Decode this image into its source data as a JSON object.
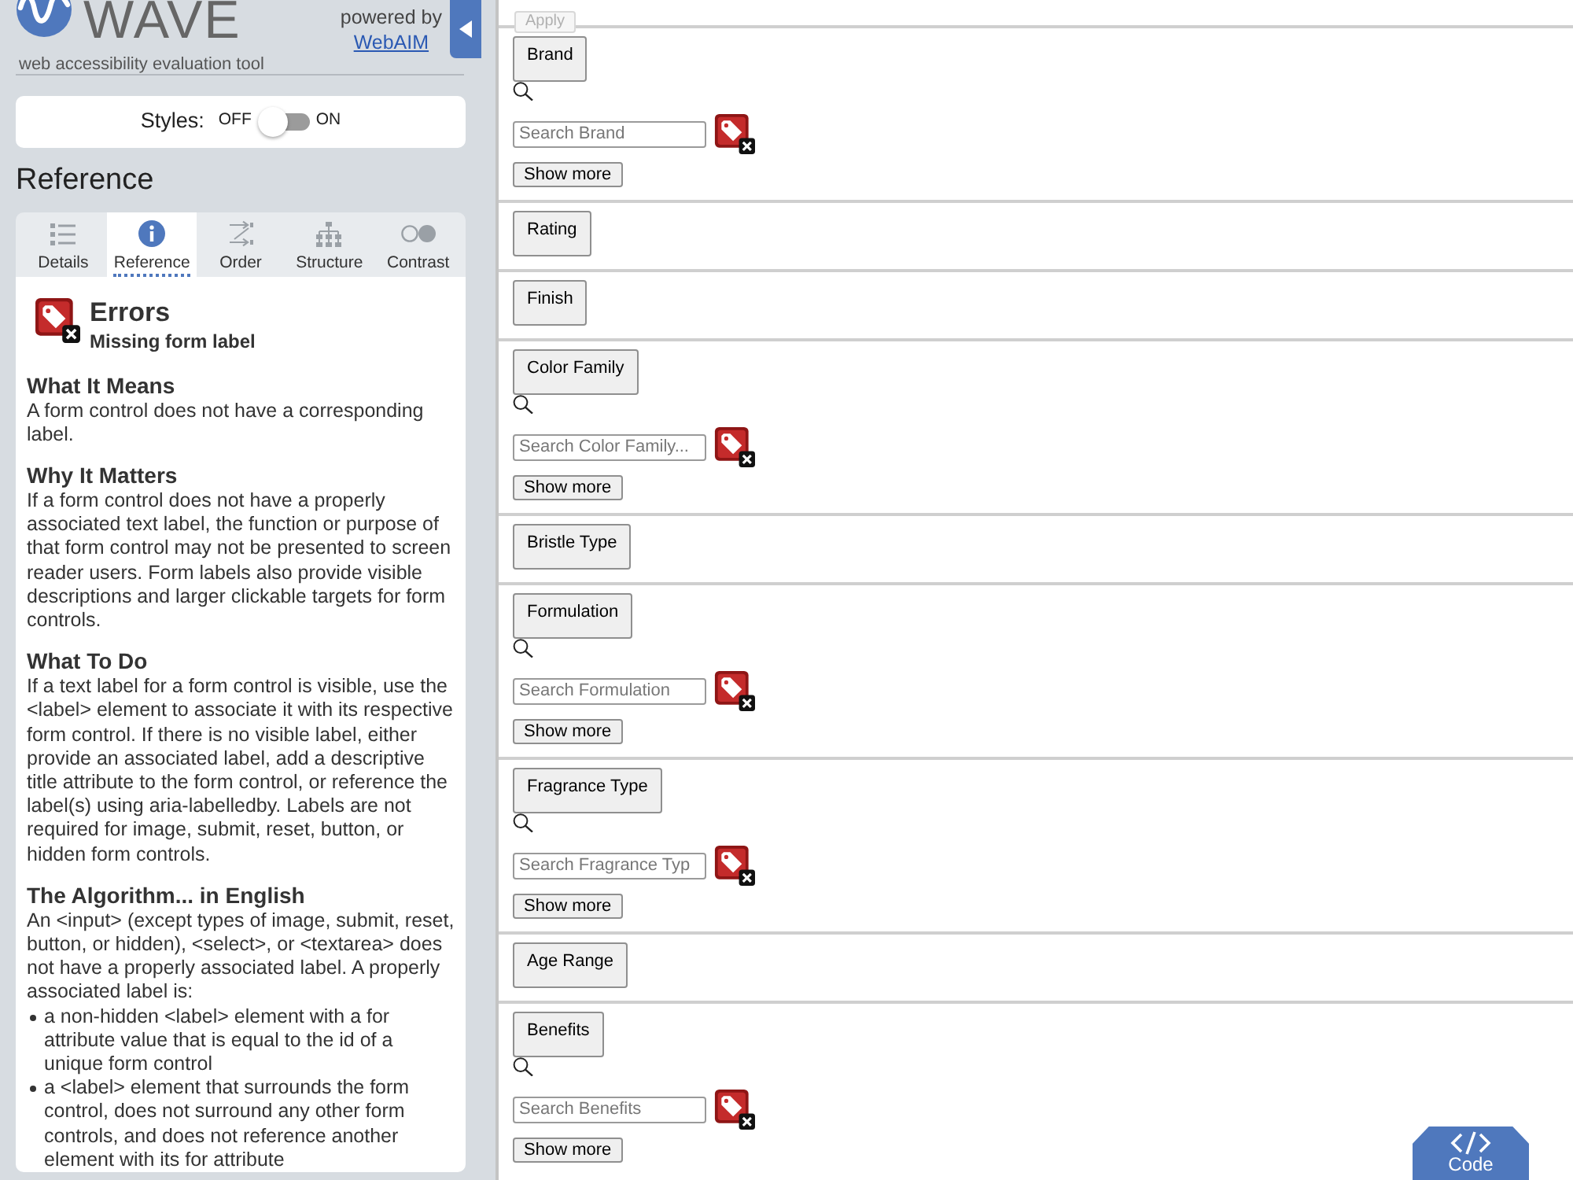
{
  "sidebar": {
    "logo": {
      "title": "WAVE",
      "tagline": "web accessibility evaluation tool"
    },
    "powered_by": {
      "text": "powered by",
      "link": "WebAIM"
    },
    "styles_toggle": {
      "label": "Styles:",
      "off_label": "OFF",
      "on_label": "ON",
      "on": false
    },
    "panel_title": "Reference",
    "tabs": [
      {
        "label": "Details",
        "kind": "details",
        "selected": false
      },
      {
        "label": "Reference",
        "kind": "reference",
        "selected": true
      },
      {
        "label": "Order",
        "kind": "order",
        "selected": false
      },
      {
        "label": "Structure",
        "kind": "structure",
        "selected": false
      },
      {
        "label": "Contrast",
        "kind": "contrast",
        "selected": false
      }
    ],
    "reference": {
      "category": "Errors",
      "title": "Missing form label",
      "sections": [
        {
          "heading": "What It Means",
          "text": "A form control does not have a corresponding label."
        },
        {
          "heading": "Why It Matters",
          "text": "If a form control does not have a properly associated text label, the function or purpose of that form control may not be presented to screen reader users. Form labels also provide visible descriptions and larger clickable targets for form controls."
        },
        {
          "heading": "What To Do",
          "text": "If a text label for a form control is visible, use the <label> element to associate it with its respective form control. If there is no visible label, either provide an associated label, add a descriptive title attribute to the form control, or reference the label(s) using aria-labelledby. Labels are not required for image, submit, reset, button, or hidden form controls."
        },
        {
          "heading": "The Algorithm... in English",
          "text": "An <input> (except types of image, submit, reset, button, or hidden), <select>, or <textarea> does not have a properly associated label. A properly associated label is:",
          "bullets": [
            "a non-hidden <label> element with a for attribute value that is equal to the id of a unique form control",
            "a <label> element that surrounds the form control, does not surround any other form controls, and does not reference another element with its for attribute"
          ]
        }
      ]
    }
  },
  "filters": {
    "apply": {
      "label": "Apply",
      "disabled": true
    },
    "groups": [
      {
        "label": "Brand",
        "kind": "searchable",
        "search": {
          "placeholder": "Search Brand"
        },
        "show_more": "Show more"
      },
      {
        "label": "Rating",
        "kind": "collapsed"
      },
      {
        "label": "Finish",
        "kind": "collapsed"
      },
      {
        "label": "Color Family",
        "kind": "searchable",
        "search": {
          "placeholder": "Search Color Family..."
        },
        "show_more": "Show more"
      },
      {
        "label": "Bristle Type",
        "kind": "collapsed"
      },
      {
        "label": "Formulation",
        "kind": "searchable",
        "search": {
          "placeholder": "Search Formulation"
        },
        "show_more": "Show more"
      },
      {
        "label": "Fragrance Type",
        "kind": "searchable",
        "search": {
          "placeholder": "Search Fragrance Typ"
        },
        "show_more": "Show more"
      },
      {
        "label": "Age Range",
        "kind": "collapsed"
      },
      {
        "label": "Benefits",
        "kind": "searchable",
        "search": {
          "placeholder": "Search Benefits"
        },
        "show_more": "Show more"
      }
    ]
  },
  "code_button": {
    "label": "Code"
  }
}
